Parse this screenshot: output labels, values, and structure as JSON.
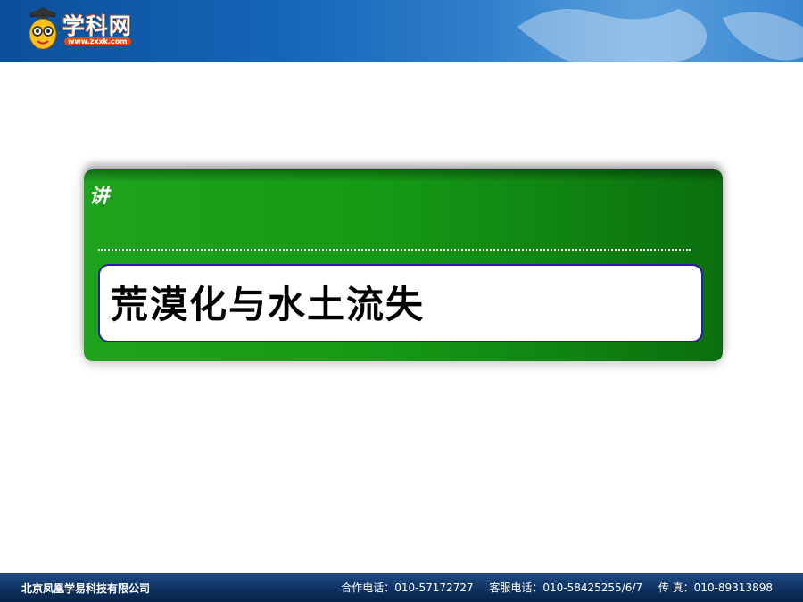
{
  "header": {
    "brand_name": "学科网",
    "brand_url": "www.zxxk.com"
  },
  "title_card": {
    "lecture_label": "讲",
    "title": "荒漠化与水土流失"
  },
  "footer": {
    "company": "北京凤凰学易科技有限公司",
    "contacts": [
      "合作电话：010-57172727",
      "客服电话：010-58425255/6/7",
      "传 真：010-89313898"
    ]
  },
  "colors": {
    "header_blue": "#1565b8",
    "card_green": "#169a16",
    "title_box_border": "#2c1aa8",
    "footer_navy": "#0d2f5e"
  }
}
